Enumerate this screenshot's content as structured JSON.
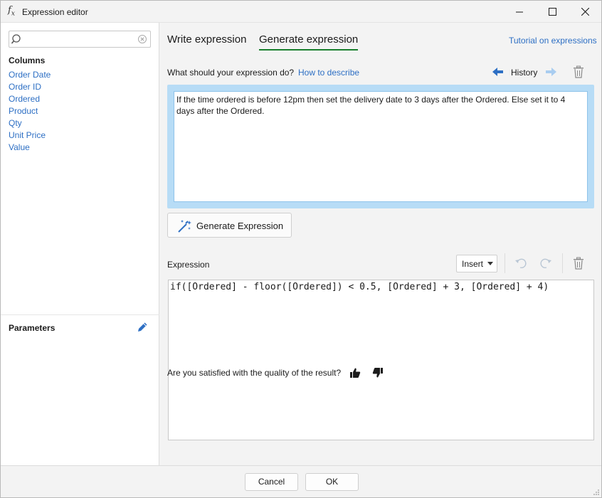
{
  "window": {
    "title": "Expression editor",
    "icon": "fx-icon",
    "controls": [
      "minimize-icon",
      "maximize-icon",
      "close-icon"
    ]
  },
  "sidebar": {
    "search": {
      "value": "",
      "placeholder": ""
    },
    "columns_title": "Columns",
    "columns": [
      {
        "label": "Order Date"
      },
      {
        "label": "Order ID"
      },
      {
        "label": "Ordered"
      },
      {
        "label": "Product"
      },
      {
        "label": "Qty"
      },
      {
        "label": "Unit Price"
      },
      {
        "label": "Value"
      }
    ],
    "parameters_title": "Parameters"
  },
  "tabs": {
    "items": [
      {
        "label": "Write expression",
        "active": false
      },
      {
        "label": "Generate expression",
        "active": true
      }
    ],
    "tutorial_link": "Tutorial on expressions"
  },
  "prompt": {
    "label": "What should your expression do?",
    "how_link": "How to describe",
    "history_label": "History",
    "text": "If the time ordered is before 12pm then set the delivery date to 3 days after the Ordered. Else set it to 4 days after the Ordered."
  },
  "generate_button": {
    "label": "Generate Expression"
  },
  "expression": {
    "label": "Expression",
    "insert_label": "Insert",
    "code": "if([Ordered] - floor([Ordered]) < 0.5, [Ordered] + 3, [Ordered] + 4)",
    "feedback_question": "Are you satisfied with the quality of the result?"
  },
  "footer": {
    "cancel_label": "Cancel",
    "ok_label": "OK"
  },
  "colors": {
    "link": "#2d6fc4",
    "active_tab_underline": "#1a7f2e",
    "prompt_highlight": "#b7dcf6"
  }
}
